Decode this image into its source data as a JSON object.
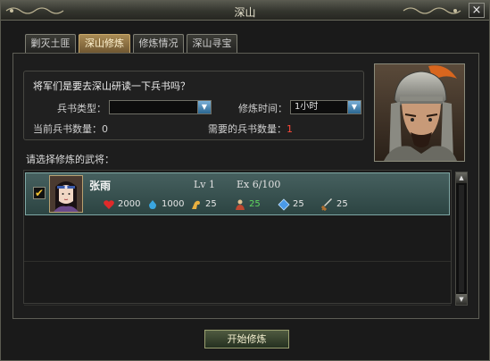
{
  "window": {
    "title": "深山",
    "close_label": "×"
  },
  "tabs": [
    {
      "label": "剿灭土匪",
      "active": false
    },
    {
      "label": "深山修炼",
      "active": true
    },
    {
      "label": "修炼情况",
      "active": false
    },
    {
      "label": "深山寻宝",
      "active": false
    }
  ],
  "training": {
    "question": "将军们是要去深山研读一下兵书吗？",
    "book_type_label": "兵书类型：",
    "book_type_value": "",
    "time_label": "修炼时间：",
    "time_value": "1小时",
    "current_books_label": "当前兵书数量：",
    "current_books_value": "0",
    "needed_books_label": "需要的兵书数量：",
    "needed_books_value": "1"
  },
  "general_select_label": "请选择修炼的武将：",
  "generals": [
    {
      "name": "张雨",
      "level": "Lv 1",
      "exp": "Ex 6/100",
      "checked": true,
      "stats": {
        "hp": "2000",
        "mp": "1000",
        "strength": "25",
        "command": "25",
        "intelligence": "25",
        "speed": "25"
      }
    }
  ],
  "buttons": {
    "start_training": "开始修炼"
  },
  "colors": {
    "tab_active": "#a98b55",
    "selected_row": "#46605f",
    "needed_count": "#ff4a3a"
  }
}
